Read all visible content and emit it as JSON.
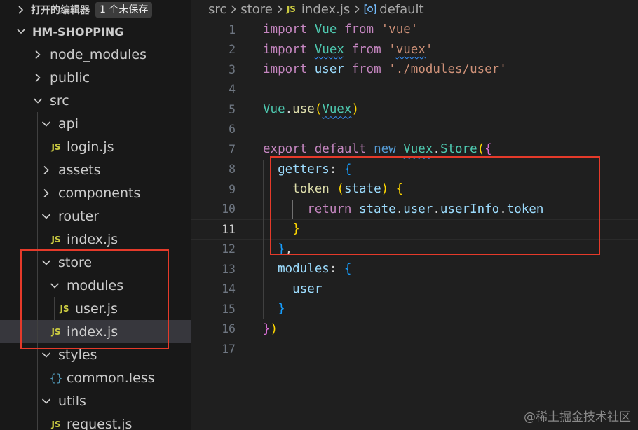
{
  "open_editors": {
    "title": "打开的编辑器",
    "badge": "1 个未保存"
  },
  "project": {
    "name": "HM-SHOPPING"
  },
  "tree": [
    {
      "label": "node_modules",
      "type": "folder",
      "expanded": false,
      "depth": 0
    },
    {
      "label": "public",
      "type": "folder",
      "expanded": false,
      "depth": 0
    },
    {
      "label": "src",
      "type": "folder",
      "expanded": true,
      "depth": 0
    },
    {
      "label": "api",
      "type": "folder",
      "expanded": true,
      "depth": 1
    },
    {
      "label": "login.js",
      "type": "js",
      "depth": 2
    },
    {
      "label": "assets",
      "type": "folder",
      "expanded": false,
      "depth": 1
    },
    {
      "label": "components",
      "type": "folder",
      "expanded": false,
      "depth": 1
    },
    {
      "label": "router",
      "type": "folder",
      "expanded": true,
      "depth": 1
    },
    {
      "label": "index.js",
      "type": "js",
      "depth": 2
    },
    {
      "label": "store",
      "type": "folder",
      "expanded": true,
      "depth": 1
    },
    {
      "label": "modules",
      "type": "folder",
      "expanded": true,
      "depth": 2
    },
    {
      "label": "user.js",
      "type": "js",
      "depth": 3
    },
    {
      "label": "index.js",
      "type": "js",
      "depth": 2,
      "selected": true
    },
    {
      "label": "styles",
      "type": "folder",
      "expanded": true,
      "depth": 1
    },
    {
      "label": "common.less",
      "type": "less",
      "depth": 2
    },
    {
      "label": "utils",
      "type": "folder",
      "expanded": true,
      "depth": 1
    },
    {
      "label": "request.js",
      "type": "js",
      "depth": 2
    }
  ],
  "icons": {
    "js_file": "JS",
    "less_file": "{}"
  },
  "breadcrumb": {
    "items": [
      "src",
      "store",
      "index.js",
      "default"
    ]
  },
  "editor": {
    "current_line": 11,
    "lines": [
      {
        "n": "1",
        "tokens": [
          [
            "kw",
            "import"
          ],
          [
            "plain",
            " "
          ],
          [
            "cls",
            "Vue"
          ],
          [
            "plain",
            " "
          ],
          [
            "kw",
            "from"
          ],
          [
            "plain",
            " "
          ],
          [
            "str",
            "'vue'"
          ]
        ]
      },
      {
        "n": "2",
        "tokens": [
          [
            "kw",
            "import"
          ],
          [
            "plain",
            " "
          ],
          [
            "cls",
            "Vuex",
            "squig"
          ],
          [
            "plain",
            " "
          ],
          [
            "kw",
            "from"
          ],
          [
            "plain",
            " "
          ],
          [
            "str",
            "'"
          ],
          [
            "str",
            "vuex",
            "squig"
          ],
          [
            "str",
            "'"
          ]
        ]
      },
      {
        "n": "3",
        "tokens": [
          [
            "kw",
            "import"
          ],
          [
            "plain",
            " "
          ],
          [
            "var",
            "user"
          ],
          [
            "plain",
            " "
          ],
          [
            "kw",
            "from"
          ],
          [
            "plain",
            " "
          ],
          [
            "str",
            "'./modules/user'"
          ]
        ]
      },
      {
        "n": "4",
        "tokens": []
      },
      {
        "n": "5",
        "tokens": [
          [
            "cls",
            "Vue"
          ],
          [
            "plain",
            "."
          ],
          [
            "fn",
            "use"
          ],
          [
            "br1",
            "("
          ],
          [
            "cls",
            "Vuex",
            "squig"
          ],
          [
            "br1",
            ")"
          ]
        ]
      },
      {
        "n": "6",
        "tokens": []
      },
      {
        "n": "7",
        "tokens": [
          [
            "kw",
            "export"
          ],
          [
            "plain",
            " "
          ],
          [
            "kw",
            "default"
          ],
          [
            "plain",
            " "
          ],
          [
            "kw2",
            "new"
          ],
          [
            "plain",
            " "
          ],
          [
            "cls",
            "Vuex",
            "squig"
          ],
          [
            "plain",
            "."
          ],
          [
            "cls",
            "Store"
          ],
          [
            "br1",
            "("
          ],
          [
            "br2",
            "{"
          ]
        ]
      },
      {
        "n": "8",
        "tokens": [
          [
            "plain",
            "  "
          ],
          [
            "var",
            "getters"
          ],
          [
            "plain",
            ": "
          ],
          [
            "br3",
            "{"
          ]
        ]
      },
      {
        "n": "9",
        "tokens": [
          [
            "plain",
            "    "
          ],
          [
            "fn",
            "token"
          ],
          [
            "plain",
            " "
          ],
          [
            "br1",
            "("
          ],
          [
            "var",
            "state"
          ],
          [
            "br1",
            ")"
          ],
          [
            "plain",
            " "
          ],
          [
            "br1",
            "{"
          ]
        ]
      },
      {
        "n": "10",
        "tokens": [
          [
            "plain",
            "      "
          ],
          [
            "kw",
            "return"
          ],
          [
            "plain",
            " "
          ],
          [
            "var",
            "state"
          ],
          [
            "plain",
            "."
          ],
          [
            "var",
            "user"
          ],
          [
            "plain",
            "."
          ],
          [
            "var",
            "userInfo"
          ],
          [
            "plain",
            "."
          ],
          [
            "var",
            "token"
          ]
        ]
      },
      {
        "n": "11",
        "tokens": [
          [
            "plain",
            "    "
          ],
          [
            "br1",
            "}"
          ]
        ]
      },
      {
        "n": "12",
        "tokens": [
          [
            "plain",
            "  "
          ],
          [
            "br3",
            "}"
          ],
          [
            "plain",
            ","
          ]
        ]
      },
      {
        "n": "13",
        "tokens": [
          [
            "plain",
            "  "
          ],
          [
            "var",
            "modules"
          ],
          [
            "plain",
            ": "
          ],
          [
            "br3",
            "{"
          ]
        ]
      },
      {
        "n": "14",
        "tokens": [
          [
            "plain",
            "    "
          ],
          [
            "var",
            "user"
          ]
        ]
      },
      {
        "n": "15",
        "tokens": [
          [
            "plain",
            "  "
          ],
          [
            "br3",
            "}"
          ]
        ]
      },
      {
        "n": "16",
        "tokens": [
          [
            "br2",
            "}"
          ],
          [
            "br1",
            ")"
          ]
        ]
      },
      {
        "n": "17",
        "tokens": []
      }
    ]
  },
  "watermark": "@稀土掘金技术社区",
  "colors": {
    "highlight": "#e53a2a",
    "selected_row": "#37373d",
    "js_icon": "#cbcb41",
    "less_icon": "#519aba"
  }
}
